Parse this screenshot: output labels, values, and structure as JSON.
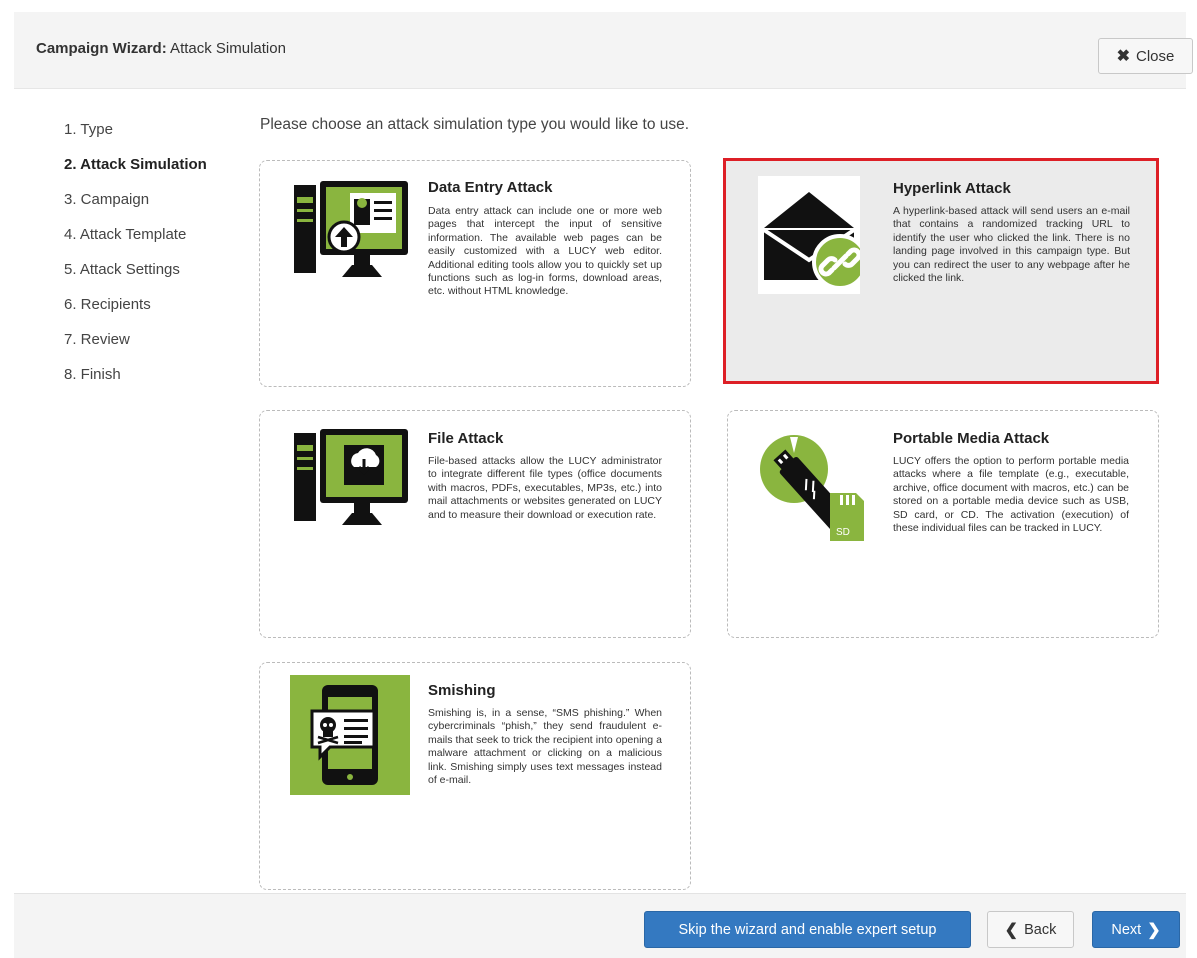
{
  "header": {
    "title_bold": "Campaign Wizard:",
    "title_rest": " Attack Simulation",
    "close_label": "Close"
  },
  "steps": [
    {
      "label": "1. Type",
      "active": false
    },
    {
      "label": "2. Attack Simulation",
      "active": true
    },
    {
      "label": "3. Campaign",
      "active": false
    },
    {
      "label": "4. Attack Template",
      "active": false
    },
    {
      "label": "5. Attack Settings",
      "active": false
    },
    {
      "label": "6. Recipients",
      "active": false
    },
    {
      "label": "7. Review",
      "active": false
    },
    {
      "label": "8. Finish",
      "active": false
    }
  ],
  "intro": "Please choose an attack simulation type you would like to use.",
  "cards": [
    {
      "title": "Data Entry Attack",
      "icon": "computer-upload-icon",
      "selected": false,
      "text": "Data entry attack can include one or more web pages that intercept the input of sensitive information. The available web pages can be easily customized with a LUCY web editor. Additional editing tools allow you to quickly set up functions such as log-in forms, download areas, etc. without HTML knowledge."
    },
    {
      "title": "Hyperlink Attack",
      "icon": "envelope-link-icon",
      "selected": true,
      "text": "A hyperlink-based attack will send users an e-mail that contains a randomized tracking URL to identify the user who clicked the link. There is no landing page involved in this campaign type. But you can redirect the user to any webpage after he clicked the link."
    },
    {
      "title": "File Attack",
      "icon": "computer-download-icon",
      "selected": false,
      "text": "File-based attacks allow the LUCY administrator to integrate different file types (office documents with macros, PDFs, executables, MP3s, etc.) into mail attachments or websites generated on LUCY and to measure their download or execution rate."
    },
    {
      "title": "Portable Media Attack",
      "icon": "usb-sd-cd-icon",
      "selected": false,
      "text": "LUCY offers the option to perform portable media attacks where a file template (e.g., executable, archive, office document with macros, etc.) can be stored on a portable media device such as USB, SD card, or CD. The activation (execution) of these individual files can be tracked in LUCY."
    },
    {
      "title": "Smishing",
      "icon": "phone-skull-message-icon",
      "selected": false,
      "text": "Smishing is, in a sense, “SMS phishing.” When cybercriminals “phish,” they send fraudulent e-mails that seek to trick the recipient into opening a malware attachment or clicking on a malicious link. Smishing simply uses text messages instead of e-mail."
    }
  ],
  "footer": {
    "skip_label": "Skip the wizard and enable expert setup",
    "back_label": "Back",
    "next_label": "Next"
  },
  "colors": {
    "accent_green": "#8ab53f",
    "primary_blue": "#3479c1",
    "selected_border": "#dd1f26"
  }
}
